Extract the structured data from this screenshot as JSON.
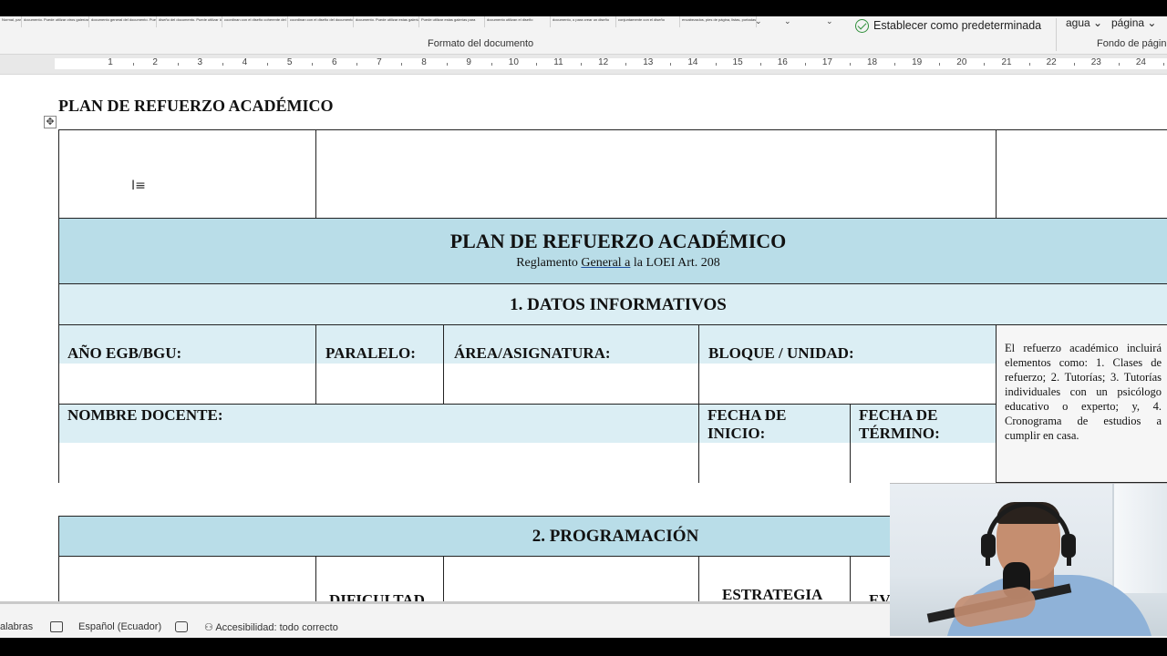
{
  "ribbon": {
    "style_gallery": [
      "Normal, para el",
      "documento. Puede utilizar otros galerías",
      "documento general del documento. Puede",
      "diseño del documento. Puede utilizar los diseños",
      "coordinan con el diseño coherente del documento",
      "coordinan con el diseño del documento",
      "documento. Puede utilizar estas galerías",
      "Puede utilizar estas galerías para",
      "documento utilizan el diseño",
      "documento, o para crear un diseño",
      "conjuntamente con el diseño",
      "encabezados, pies de página, listas, portadas y"
    ],
    "group_label": "Formato del documento",
    "set_default_label": "Establecer como predeterminada",
    "watermark_label": "agua",
    "page_color_label": "página",
    "page_background_label": "Fondo de página"
  },
  "ruler": {
    "numbers": [
      "1",
      "2",
      "3",
      "4",
      "5",
      "6",
      "7",
      "8",
      "9",
      "10",
      "11",
      "12",
      "13",
      "14",
      "15",
      "16",
      "17",
      "18",
      "19",
      "20",
      "21",
      "22",
      "23",
      "24"
    ]
  },
  "document": {
    "heading": "PLAN DE REFUERZO ACADÉMICO",
    "banner": {
      "title": "PLAN DE REFUERZO ACADÉMICO",
      "subtitle_before": "Reglamento ",
      "subtitle_link": "General  a",
      "subtitle_after": " la LOEI Art. 208"
    },
    "section1": "1. DATOS INFORMATIVOS",
    "fields": {
      "anio": "AÑO EGB/BGU:",
      "paralelo": "PARALELO:",
      "area": "ÁREA/ASIGNATURA:",
      "bloque": "BLOQUE / UNIDAD:",
      "docente": "NOMBRE DOCENTE:",
      "inicio": "FECHA DE INICIO:",
      "termino": "FECHA DE TÉRMINO:"
    },
    "side_note": "El refuerzo académico incluirá elementos como: 1. Clases de refuerzo; 2. Tutorías; 3. Tutorías individuales con un psicólogo educativo o experto; y, 4. Cronograma de estudios a cumplir en casa.",
    "section2": "2. PROGRAMACIÓN",
    "prog_headers": {
      "dificultad": "DIFICULTAD",
      "estrategia": "ESTRATEGIA",
      "evaluacion_partial": "EV"
    }
  },
  "statusbar": {
    "words": "alabras",
    "language": "Español (Ecuador)",
    "accessibility": "Accesibilidad: todo correcto"
  },
  "icons": [
    "check-circle-icon",
    "proofing-icon",
    "focus-icon",
    "accessibility-icon",
    "table-move-icon",
    "text-cursor-icon"
  ],
  "colors": {
    "banner_blue": "#b9dde8",
    "light_blue": "#dbeef4",
    "check_green": "#2f8f3a"
  }
}
